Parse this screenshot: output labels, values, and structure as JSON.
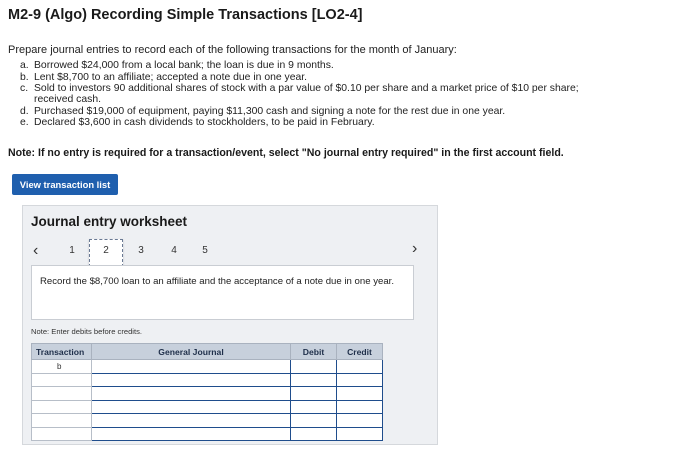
{
  "title": "M2-9 (Algo) Recording Simple Transactions [LO2-4]",
  "intro": "Prepare journal entries to record each of the following transactions for the month of January:",
  "transactions": [
    {
      "letter": "a.",
      "text": "Borrowed $24,000 from a local bank; the loan is due in 9 months."
    },
    {
      "letter": "b.",
      "text": "Lent $8,700 to an affiliate; accepted a note due in one year."
    },
    {
      "letter": "c.",
      "text": "Sold to investors 90 additional shares of stock with a par value of $0.10 per share and a market price of $10 per share; received cash."
    },
    {
      "letter": "d.",
      "text": "Purchased $19,000 of equipment, paying $11,300 cash and signing a note for the rest due in one year."
    },
    {
      "letter": "e.",
      "text": "Declared $3,600 in cash dividends to stockholders, to be paid in February."
    }
  ],
  "note": "Note: If no entry is required for a transaction/event, select \"No journal entry required\" in the first account field.",
  "view_button": "View transaction list",
  "worksheet": {
    "title": "Journal entry worksheet",
    "prev_icon": "chevron-left-icon",
    "next_icon": "chevron-right-icon",
    "pages": [
      "1",
      "2",
      "3",
      "4",
      "5"
    ],
    "active_page": "2",
    "record_text": "Record the $8,700 loan to an affiliate and the acceptance of a note due in one year.",
    "note": "Note: Enter debits before credits.",
    "headers": {
      "transaction": "Transaction",
      "general_journal": "General Journal",
      "debit": "Debit",
      "credit": "Credit"
    },
    "rows": [
      {
        "transaction": "b",
        "account": "",
        "debit": "",
        "credit": ""
      },
      {
        "transaction": "",
        "account": "",
        "debit": "",
        "credit": ""
      },
      {
        "transaction": "",
        "account": "",
        "debit": "",
        "credit": ""
      },
      {
        "transaction": "",
        "account": "",
        "debit": "",
        "credit": ""
      },
      {
        "transaction": "",
        "account": "",
        "debit": "",
        "credit": ""
      },
      {
        "transaction": "",
        "account": "",
        "debit": "",
        "credit": ""
      }
    ]
  }
}
